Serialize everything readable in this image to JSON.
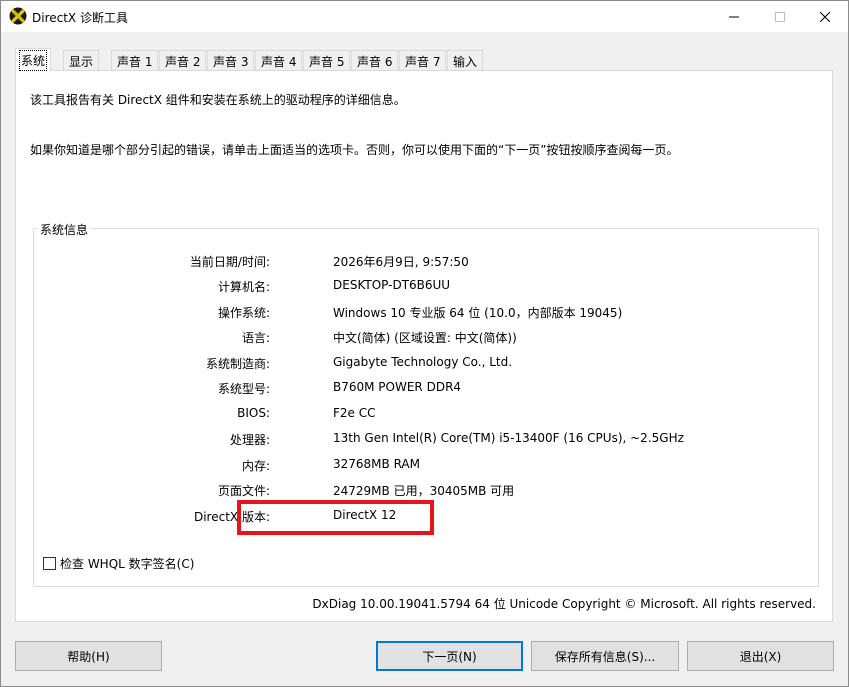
{
  "window": {
    "title": "DirectX 诊断工具"
  },
  "tabs": [
    "系统",
    "显示",
    "声音 1",
    "声音 2",
    "声音 3",
    "声音 4",
    "声音 5",
    "声音 6",
    "声音 7",
    "输入"
  ],
  "description": {
    "line1": "该工具报告有关 DirectX 组件和安装在系统上的驱动程序的详细信息。",
    "line2": "如果你知道是哪个部分引起的错误，请单击上面适当的选项卡。否则，你可以使用下面的“下一页”按钮按顺序查阅每一页。"
  },
  "system_info": {
    "legend": "系统信息",
    "rows": [
      {
        "label": "当前日期/时间:",
        "value": "2026年6月9日, 9:57:50"
      },
      {
        "label": "计算机名:",
        "value": "DESKTOP-DT6B6UU"
      },
      {
        "label": "操作系统:",
        "value": "Windows 10 专业版 64 位 (10.0，内部版本 19045)"
      },
      {
        "label": "语言:",
        "value": "中文(简体) (区域设置: 中文(简体))"
      },
      {
        "label": "系统制造商:",
        "value": "Gigabyte Technology Co., Ltd."
      },
      {
        "label": "系统型号:",
        "value": "B760M POWER DDR4"
      },
      {
        "label": "BIOS:",
        "value": "F2e CC"
      },
      {
        "label": "处理器:",
        "value": "13th Gen Intel(R) Core(TM) i5-13400F (16 CPUs), ~2.5GHz"
      },
      {
        "label": "内存:",
        "value": "32768MB RAM"
      },
      {
        "label": "页面文件:",
        "value": "24729MB 已用，30405MB 可用"
      },
      {
        "label": "DirectX 版本:",
        "value": "DirectX 12"
      }
    ]
  },
  "checkbox": {
    "label": "检查 WHQL 数字签名(C)",
    "checked": false
  },
  "footer": "DxDiag 10.00.19041.5794 64 位 Unicode  Copyright © Microsoft. All rights reserved.",
  "buttons": {
    "help": "帮助(H)",
    "next": "下一页(N)",
    "save": "保存所有信息(S)...",
    "exit": "退出(X)"
  },
  "colors": {
    "highlight": "#e8141b",
    "default_button_border": "#0078d7"
  }
}
